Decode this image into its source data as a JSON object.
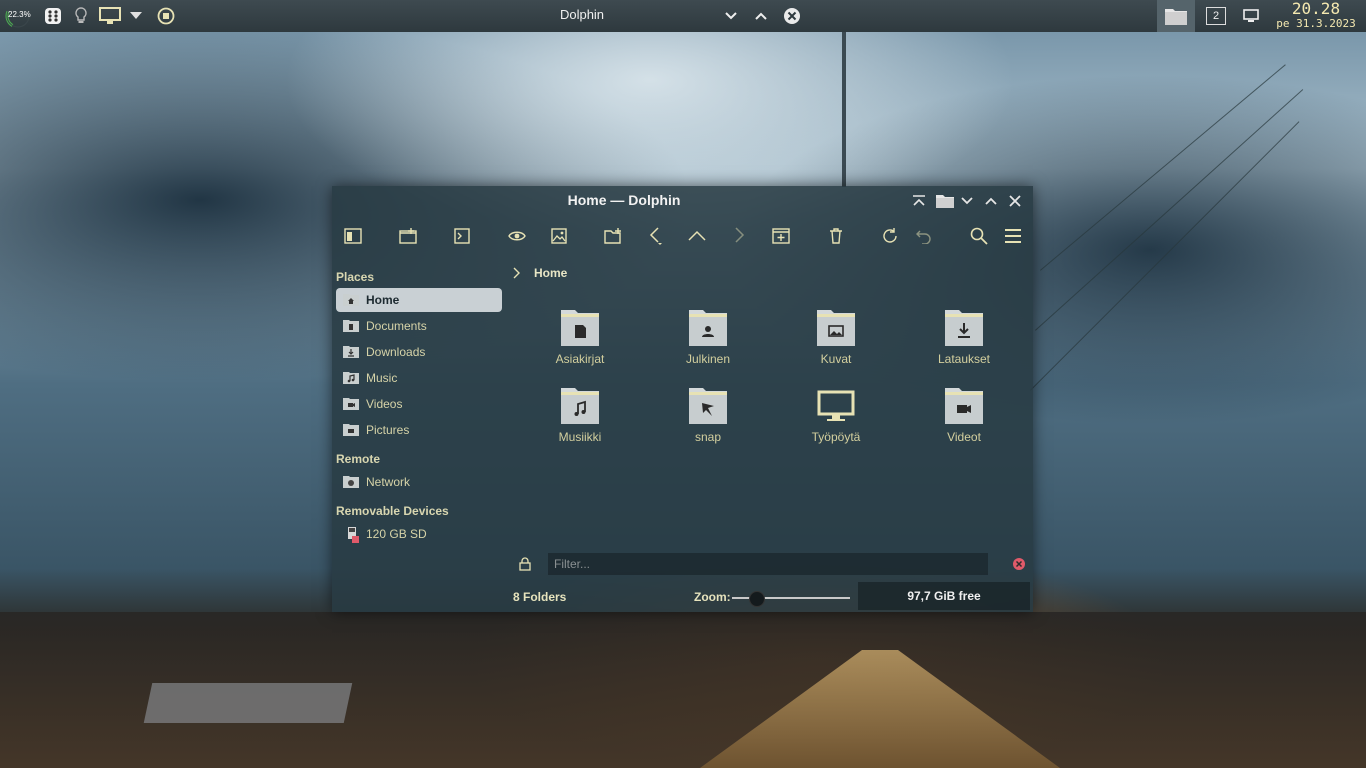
{
  "panel": {
    "battery_badge": "22.3%",
    "window_title": "Dolphin",
    "workspace_number": "2",
    "clock_time": "20.28",
    "clock_date": "pe 31.3.2023"
  },
  "window": {
    "title": "Home — Dolphin"
  },
  "sidebar": {
    "places_header": "Places",
    "places": [
      {
        "label": "Home",
        "icon": "home-folder-icon",
        "selected": true
      },
      {
        "label": "Documents",
        "icon": "documents-folder-icon"
      },
      {
        "label": "Downloads",
        "icon": "downloads-folder-icon"
      },
      {
        "label": "Music",
        "icon": "music-folder-icon"
      },
      {
        "label": "Videos",
        "icon": "videos-folder-icon"
      },
      {
        "label": "Pictures",
        "icon": "pictures-folder-icon"
      }
    ],
    "remote_header": "Remote",
    "remote": [
      {
        "label": "Network",
        "icon": "network-folder-icon"
      }
    ],
    "removable_header": "Removable Devices",
    "removable": [
      {
        "label": "120 GB SD",
        "icon": "sd-card-icon"
      }
    ]
  },
  "breadcrumb": {
    "current": "Home"
  },
  "files": [
    {
      "name": "Asiakirjat",
      "icon": "document-folder-icon"
    },
    {
      "name": "Julkinen",
      "icon": "public-folder-icon"
    },
    {
      "name": "Kuvat",
      "icon": "pictures-folder-icon"
    },
    {
      "name": "Lataukset",
      "icon": "download-folder-icon"
    },
    {
      "name": "Musiikki",
      "icon": "music-folder-icon"
    },
    {
      "name": "snap",
      "icon": "snap-folder-icon"
    },
    {
      "name": "Työpöytä",
      "icon": "desktop-monitor-icon"
    },
    {
      "name": "Videot",
      "icon": "video-folder-icon"
    }
  ],
  "filter": {
    "placeholder": "Filter..."
  },
  "status": {
    "folder_count": "8 Folders",
    "zoom_label": "Zoom:",
    "zoom_level": 0.2,
    "free_space": "97,7 GiB free"
  },
  "colors": {
    "accent_yellow": "#e7e2b4",
    "selection_bg": "#c9d0d4",
    "close_red": "#e05a6a"
  }
}
